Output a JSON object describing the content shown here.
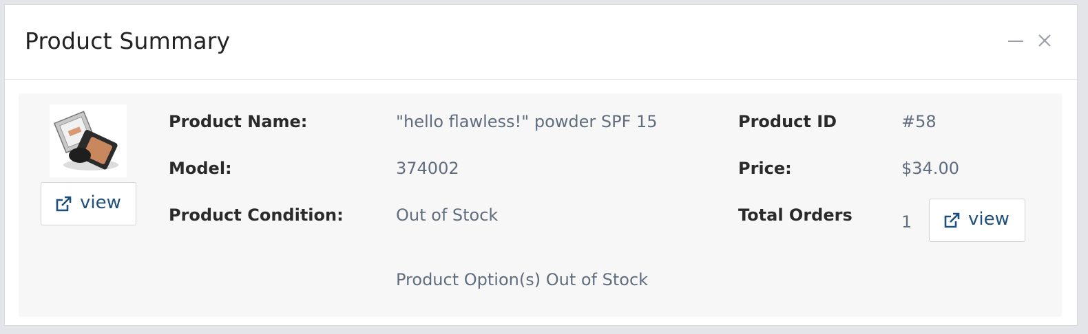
{
  "panel": {
    "title": "Product Summary",
    "minimize_icon": "minus-icon",
    "close_icon": "close-icon"
  },
  "product": {
    "image_alt": "product thumbnail (compact powder)",
    "view_button": {
      "icon": "external-link-icon",
      "label": "view"
    },
    "fields": {
      "name_label": "Product Name:",
      "name_value": "\"hello flawless!\" powder SPF 15",
      "model_label": "Model:",
      "model_value": "374002",
      "condition_label": "Product Condition:",
      "condition_value": "Out of Stock",
      "options_value": "Product Option(s) Out of Stock",
      "id_label": "Product ID",
      "id_value": "#58",
      "price_label": "Price:",
      "price_value": "$34.00",
      "orders_label": "Total Orders",
      "orders_value": "1"
    },
    "orders_view_button": {
      "icon": "external-link-icon",
      "label": "view"
    }
  },
  "colors": {
    "link": "#1d4f7c",
    "value_text": "#5f6d7e",
    "body_bg": "#f7f7f7"
  }
}
